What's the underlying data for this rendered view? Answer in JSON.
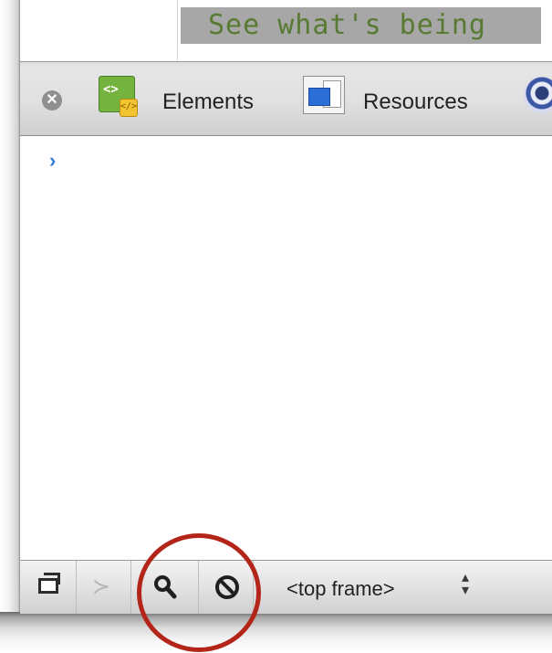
{
  "banner": {
    "text": "See what's being"
  },
  "toolbar": {
    "close": {
      "icon": "close-circle-icon",
      "glyph": "✕"
    },
    "tabs": [
      {
        "label": "Elements",
        "icon": "elements-icon",
        "icon_text": "<>"
      },
      {
        "label": "Resources",
        "icon": "resources-icon"
      },
      {
        "label": "",
        "icon": "network-globe-icon"
      }
    ]
  },
  "console": {
    "prompt": "›"
  },
  "statusbar": {
    "dock_icon": "dock-to-window-icon",
    "drawer_icon": "console-drawer-icon",
    "drawer_glyph": "≻",
    "search_icon": "search-icon",
    "search_glyph": "🔍",
    "clear_icon": "clear-console-icon",
    "clear_glyph": "⦸",
    "frame_select": {
      "value": "<top frame>",
      "arrows_glyph": "▴▾"
    }
  },
  "colors": {
    "banner_bg": "#a7a7a7",
    "banner_text": "#587a32",
    "prompt": "#2f7dd6",
    "annotation": "#b22518",
    "elements_icon": "#73b33e"
  }
}
